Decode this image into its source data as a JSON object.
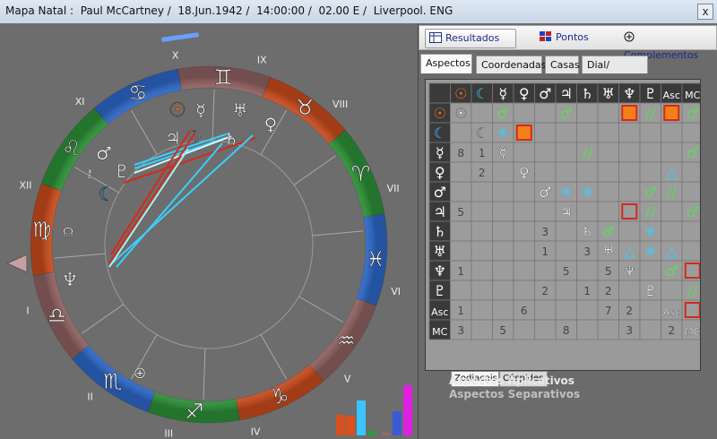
{
  "window": {
    "title": "Mapa Natal :  Paul McCartney /  18.Jun.1942 /  14:00:00 /  02.00 E /  Liverpool. ENG",
    "close_label": "x"
  },
  "toolbar": {
    "results_label": "Resultados",
    "points_label": "Pontos",
    "complements_label": "Complementos"
  },
  "tabs": [
    "Aspectos",
    "Coordenadas",
    "Casas",
    "Dial/ Enquadr"
  ],
  "subtabs": [
    "Zodiacais",
    "Cúspides"
  ],
  "legend": {
    "applying": "Aspectos Aplicativos",
    "separating": "Aspectos Separativos"
  },
  "house_numerals": [
    "I",
    "II",
    "III",
    "IV",
    "V",
    "VI",
    "VII",
    "VIII",
    "IX",
    "X",
    "XI",
    "XII"
  ],
  "aspect_grid": {
    "header_symbols": [
      "☉",
      "☾",
      "☿",
      "♀",
      "♂",
      "♃",
      "♄",
      "♅",
      "♆",
      "♇",
      "Asc",
      "MC"
    ],
    "header_colors": [
      "#e8701a",
      "#39c6ff",
      "#ffffff",
      "#ffffff",
      "#ffffff",
      "#ffffff",
      "#ffffff",
      "#ffffff",
      "#ffffff",
      "#ffffff",
      "#ffffff",
      "#ffffff"
    ],
    "cells": [
      [
        0,
        2,
        "sextile"
      ],
      [
        0,
        5,
        "sextile"
      ],
      [
        0,
        8,
        "square"
      ],
      [
        0,
        9,
        "quincunx"
      ],
      [
        0,
        10,
        "square"
      ],
      [
        0,
        11,
        "sextile"
      ],
      [
        1,
        2,
        "opposition"
      ],
      [
        1,
        3,
        "square"
      ],
      [
        2,
        0,
        "8"
      ],
      [
        2,
        1,
        "1"
      ],
      [
        2,
        6,
        "quincunx"
      ],
      [
        2,
        11,
        "sextile"
      ],
      [
        3,
        1,
        "2"
      ],
      [
        3,
        10,
        "trine"
      ],
      [
        4,
        5,
        "opposition"
      ],
      [
        4,
        6,
        "opposition"
      ],
      [
        4,
        9,
        "sextile"
      ],
      [
        4,
        10,
        "quincunx"
      ],
      [
        5,
        0,
        "5"
      ],
      [
        5,
        8,
        "square"
      ],
      [
        5,
        9,
        "quincunx"
      ],
      [
        5,
        11,
        "sextile"
      ],
      [
        6,
        4,
        "3"
      ],
      [
        6,
        7,
        "sextile"
      ],
      [
        6,
        9,
        "opposition"
      ],
      [
        7,
        4,
        "1"
      ],
      [
        7,
        6,
        "3"
      ],
      [
        7,
        8,
        "trine"
      ],
      [
        7,
        9,
        "opposition"
      ],
      [
        7,
        10,
        "trine"
      ],
      [
        8,
        0,
        "1"
      ],
      [
        8,
        5,
        "5"
      ],
      [
        8,
        7,
        "5"
      ],
      [
        8,
        10,
        "sextile"
      ],
      [
        8,
        11,
        "square"
      ],
      [
        9,
        4,
        "2"
      ],
      [
        9,
        6,
        "1"
      ],
      [
        9,
        7,
        "2"
      ],
      [
        9,
        11,
        "quincunx"
      ],
      [
        10,
        0,
        "1"
      ],
      [
        10,
        3,
        "6"
      ],
      [
        10,
        7,
        "7"
      ],
      [
        10,
        8,
        "2"
      ],
      [
        10,
        11,
        "square"
      ],
      [
        11,
        0,
        "3"
      ],
      [
        11,
        2,
        "5"
      ],
      [
        11,
        5,
        "8"
      ],
      [
        11,
        8,
        "3"
      ],
      [
        11,
        10,
        "2"
      ]
    ]
  },
  "colors": {
    "fire": "#d8501e",
    "earth": "#2f9a3a",
    "air": "#2f6fd6",
    "water": "#9a6868",
    "sun": "#e8701a",
    "moon": "#39c6ff",
    "aspect_green": "#5fd85f",
    "aspect_red": "#d42a1a",
    "aspect_cyan": "#38d0ff",
    "grid_text": "#444444"
  }
}
